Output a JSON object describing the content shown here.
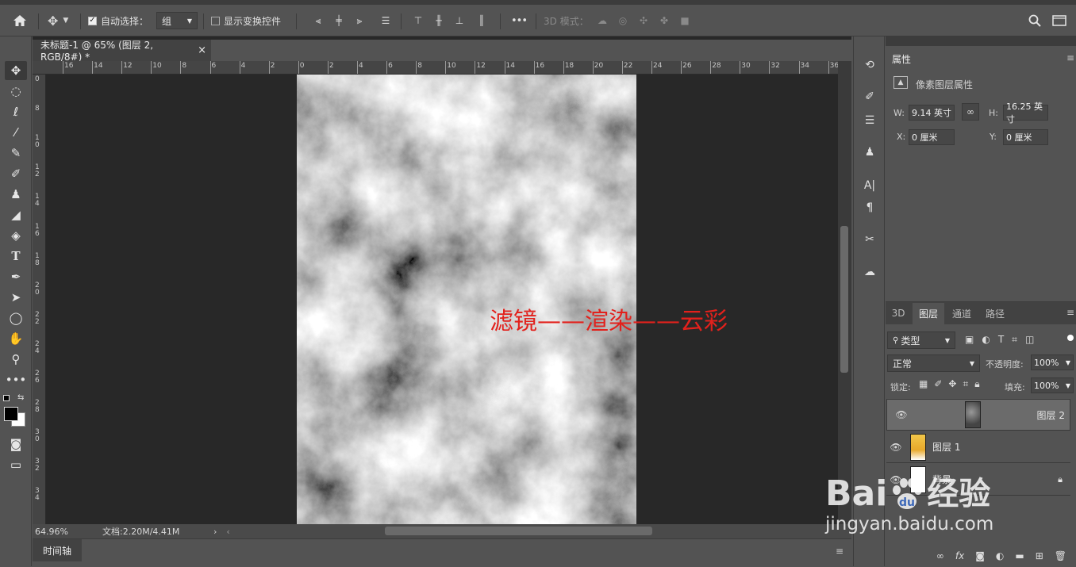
{
  "options_bar": {
    "auto_select_label": "自动选择：",
    "auto_select_value": "组",
    "show_transform_label": "显示变换控件",
    "more_label": "•••",
    "mode_3d_label": "3D 模式："
  },
  "document": {
    "tab_title": "未标题-1 @ 65% (图层 2, RGB/8#) *",
    "close_glyph": "×",
    "zoom": "64.96%",
    "doc_size": "文档:2.20M/4.41M",
    "overlay_text": "滤镜——渲染——云彩",
    "hruler_labels": [
      "16",
      "14",
      "12",
      "10",
      "8",
      "6",
      "4",
      "2",
      "0",
      "2",
      "4",
      "6",
      "8",
      "10",
      "12",
      "14",
      "16",
      "18",
      "20",
      "22",
      "24",
      "26",
      "28",
      "30",
      "32",
      "34",
      "36"
    ],
    "vruler_labels": [
      "0",
      "8",
      "10",
      "12",
      "14",
      "16",
      "18",
      "20",
      "22",
      "24",
      "26",
      "28",
      "30",
      "32",
      "34"
    ]
  },
  "timeline": {
    "label": "时间轴"
  },
  "properties": {
    "tab": "属性",
    "title": "像素图层属性",
    "w_label": "W:",
    "w_value": "9.14 英寸",
    "h_label": "H:",
    "h_value": "16.25 英寸",
    "x_label": "X:",
    "x_value": "0 厘米",
    "y_label": "Y:",
    "y_value": "0 厘米"
  },
  "layers_panel": {
    "tabs": [
      "3D",
      "图层",
      "通道",
      "路径"
    ],
    "filter_kind": "类型",
    "blend_mode": "正常",
    "opacity_label": "不透明度:",
    "opacity_value": "100%",
    "lock_label": "锁定:",
    "fill_label": "填充:",
    "fill_value": "100%",
    "layers": [
      {
        "name": "图层 2",
        "selected": true
      },
      {
        "name": "图层 1",
        "selected": false
      },
      {
        "name": "背景",
        "selected": false
      }
    ]
  },
  "watermark": {
    "brand": "Bai",
    "brand_cn": "经验",
    "url": "jingyan.baidu.com"
  },
  "colors": {
    "accent_red": "#e2211c",
    "panel": "#535353",
    "canvas_bg": "#282828"
  }
}
